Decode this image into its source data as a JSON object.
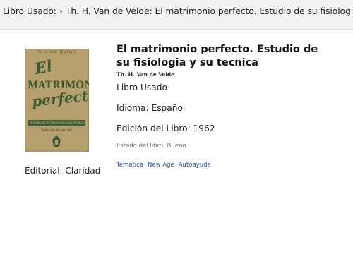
{
  "breadcrumb": {
    "root": "Libro Usado:",
    "separator": "›",
    "current": "Th. H. Van de Velde: El matrimonio perfecto. Estudio de su fisiologia y su tecnica"
  },
  "book": {
    "title": "El matrimonio perfecto. Estudio de su fisiologia y su tecnica",
    "author": "Th. H. Van de Velde",
    "condition_type": "Libro Usado",
    "language": "Idioma: Español",
    "edition_year": "Edición del Libro: 1962",
    "state": "Estado del libro: Bueno",
    "publisher": "Editorial: Claridad",
    "tags": [
      "Temática",
      "New Age",
      "Autoayuda"
    ]
  },
  "cover": {
    "author": "TH. H. VAN DE VELDE",
    "title_line1": "El",
    "title_line2": "MATRIMONIO",
    "title_line3": "perfecto",
    "band_text": "ESTUDIO DE SU FISIOLOGIA Y SU TECNICA",
    "edition": "Edición ilustrada",
    "colors": {
      "paper": "#b59f6d",
      "ink": "#3d5a34"
    }
  },
  "colors": {
    "link": "#1f4e9c",
    "breadcrumb_bg": "#f2f2f2",
    "muted": "#777777"
  }
}
